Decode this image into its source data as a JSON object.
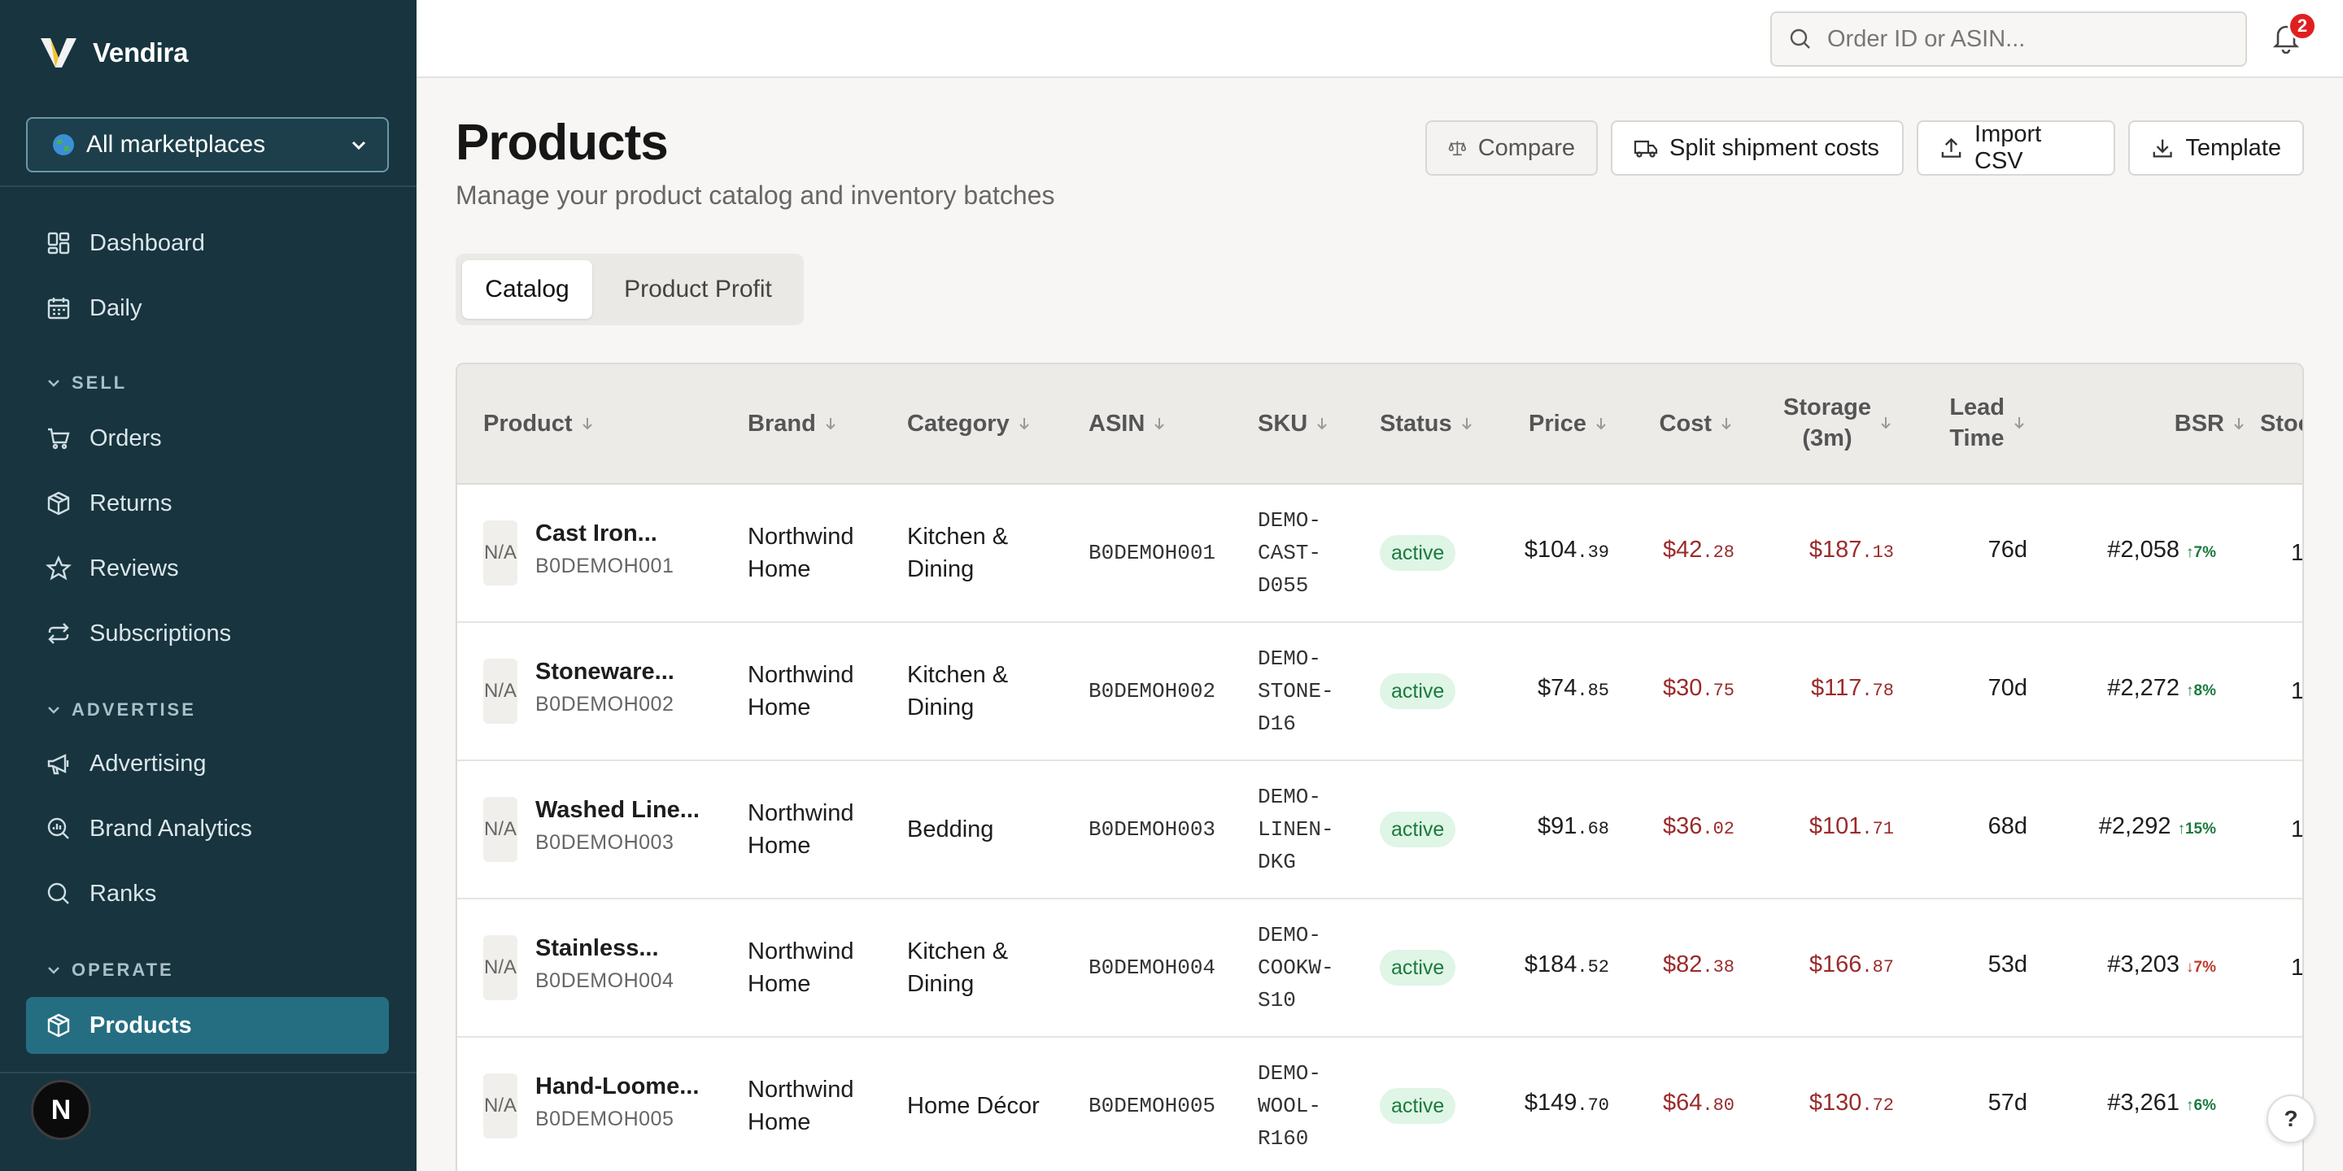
{
  "app": {
    "name": "Vendira"
  },
  "sidebar": {
    "marketplace": "All marketplaces",
    "top_items": [
      {
        "label": "Dashboard",
        "icon": "dashboard-icon"
      },
      {
        "label": "Daily",
        "icon": "calendar-icon"
      }
    ],
    "sections": [
      {
        "title": "SELL",
        "items": [
          {
            "label": "Orders",
            "icon": "cart-icon"
          },
          {
            "label": "Returns",
            "icon": "box-icon"
          },
          {
            "label": "Reviews",
            "icon": "star-icon"
          },
          {
            "label": "Subscriptions",
            "icon": "repeat-icon"
          }
        ]
      },
      {
        "title": "ADVERTISE",
        "items": [
          {
            "label": "Advertising",
            "icon": "megaphone-icon"
          },
          {
            "label": "Brand Analytics",
            "icon": "analytics-search-icon"
          },
          {
            "label": "Ranks",
            "icon": "search-icon"
          }
        ]
      },
      {
        "title": "OPERATE",
        "items": [
          {
            "label": "Products",
            "icon": "package-icon",
            "active": true
          }
        ]
      }
    ],
    "avatar_initial": "N"
  },
  "topbar": {
    "search_placeholder": "Order ID or ASIN...",
    "notifications_count": "2"
  },
  "header": {
    "title": "Products",
    "subtitle": "Manage your product catalog and inventory batches",
    "buttons": {
      "compare": "Compare",
      "split": "Split shipment costs",
      "import": "Import CSV",
      "template": "Template"
    }
  },
  "tabs": [
    {
      "label": "Catalog",
      "active": true
    },
    {
      "label": "Product Profit",
      "active": false
    }
  ],
  "table": {
    "columns": {
      "product": "Product",
      "brand": "Brand",
      "category": "Category",
      "asin": "ASIN",
      "sku": "SKU",
      "status": "Status",
      "price": "Price",
      "cost": "Cost",
      "storage_1": "Storage",
      "storage_2": "(3m)",
      "lead_1": "Lead",
      "lead_2": "Time",
      "bsr": "BSR",
      "stock": "Stoc"
    },
    "rows": [
      {
        "image": "N/A",
        "name": "Cast Iron...",
        "asin_sub": "B0DEMOH001",
        "brand_1": "Northwind",
        "brand_2": "Home",
        "category_1": "Kitchen &",
        "category_2": "Dining",
        "asin": "B0DEMOH001",
        "sku_1": "DEMO-",
        "sku_2": "CAST-",
        "sku_3": "D055",
        "status": "active",
        "price_d": "$104",
        "price_c": ".39",
        "cost_d": "$42",
        "cost_c": ".28",
        "storage_d": "$187",
        "storage_c": ".13",
        "lead": "76d",
        "bsr": "#2,058",
        "trend": "↑7%",
        "trend_dir": "up",
        "stock": "1"
      },
      {
        "image": "N/A",
        "name": "Stoneware...",
        "asin_sub": "B0DEMOH002",
        "brand_1": "Northwind",
        "brand_2": "Home",
        "category_1": "Kitchen &",
        "category_2": "Dining",
        "asin": "B0DEMOH002",
        "sku_1": "DEMO-",
        "sku_2": "STONE-",
        "sku_3": "D16",
        "status": "active",
        "price_d": "$74",
        "price_c": ".85",
        "cost_d": "$30",
        "cost_c": ".75",
        "storage_d": "$117",
        "storage_c": ".78",
        "lead": "70d",
        "bsr": "#2,272",
        "trend": "↑8%",
        "trend_dir": "up",
        "stock": "1"
      },
      {
        "image": "N/A",
        "name": "Washed Line...",
        "asin_sub": "B0DEMOH003",
        "brand_1": "Northwind",
        "brand_2": "Home",
        "category_1": "Bedding",
        "category_2": "",
        "asin": "B0DEMOH003",
        "sku_1": "DEMO-",
        "sku_2": "LINEN-",
        "sku_3": "DKG",
        "status": "active",
        "price_d": "$91",
        "price_c": ".68",
        "cost_d": "$36",
        "cost_c": ".02",
        "storage_d": "$101",
        "storage_c": ".71",
        "lead": "68d",
        "bsr": "#2,292",
        "trend": "↑15%",
        "trend_dir": "up",
        "stock": "1"
      },
      {
        "image": "N/A",
        "name": "Stainless...",
        "asin_sub": "B0DEMOH004",
        "brand_1": "Northwind",
        "brand_2": "Home",
        "category_1": "Kitchen &",
        "category_2": "Dining",
        "asin": "B0DEMOH004",
        "sku_1": "DEMO-",
        "sku_2": "COOKW-",
        "sku_3": "S10",
        "status": "active",
        "price_d": "$184",
        "price_c": ".52",
        "cost_d": "$82",
        "cost_c": ".38",
        "storage_d": "$166",
        "storage_c": ".87",
        "lead": "53d",
        "bsr": "#3,203",
        "trend": "↓7%",
        "trend_dir": "down",
        "stock": "1"
      },
      {
        "image": "N/A",
        "name": "Hand-Loome...",
        "asin_sub": "B0DEMOH005",
        "brand_1": "Northwind",
        "brand_2": "Home",
        "category_1": "Home Décor",
        "category_2": "",
        "asin": "B0DEMOH005",
        "sku_1": "DEMO-",
        "sku_2": "WOOL-",
        "sku_3": "R160",
        "status": "active",
        "price_d": "$149",
        "price_c": ".70",
        "cost_d": "$64",
        "cost_c": ".80",
        "storage_d": "$130",
        "storage_c": ".72",
        "lead": "57d",
        "bsr": "#3,261",
        "trend": "↑6%",
        "trend_dir": "up",
        "stock": ""
      }
    ]
  },
  "help_label": "?"
}
